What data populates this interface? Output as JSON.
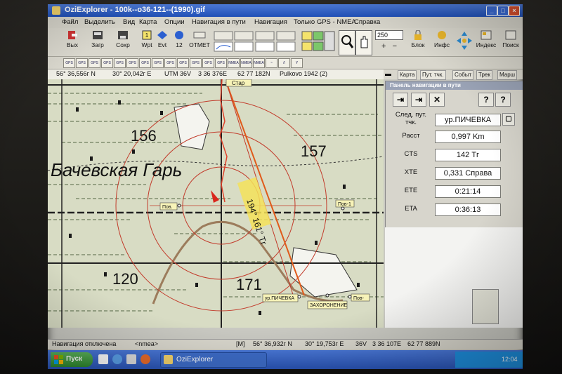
{
  "window": {
    "title": "OziExplorer - 100k--o36-121--(1990).gif"
  },
  "menu": [
    "Файл",
    "Выделить",
    "Вид",
    "Карта",
    "Опции",
    "Навигация в пути",
    "Навигация",
    "Только GPS - NMEA",
    "Справка"
  ],
  "toolbar": {
    "exit_label": "Вых",
    "load_label": "Загр",
    "save_label": "Сохр",
    "wpt_label": "Wpt",
    "evt_label": "Evt",
    "wpt_count": "12",
    "otmec_label": "ОТМЕТ",
    "zoom_value": "250",
    "block_label": "Блок",
    "info_label": "Инфс",
    "index_label": "Индекс",
    "search_label": "Поиск"
  },
  "coords": {
    "lat": "56° 36,556г N",
    "lon": "30° 20,042г E",
    "utm": "UTM  36V",
    "easting": "3 36 376E",
    "northing": "62 77 182N",
    "datum": "Pulkovo 1942 (2)"
  },
  "tabs": [
    "Карта",
    "Пут. тчк.",
    "Событ",
    "Трек",
    "Марш"
  ],
  "nav_panel": {
    "title": "Панель навигации в пути",
    "next_wpt_label": "След. пут. тчк.",
    "next_wpt_value": "ур.ПИЧЕВКА",
    "dist_label": "Расст",
    "dist_value": "0,997 Km",
    "cts_label": "CTS",
    "cts_value": "142 Тг",
    "xte_label": "XTE",
    "xte_value": "0,331 Справа",
    "ete_label": "ETE",
    "ete_value": "0:21:14",
    "eta_label": "ETA",
    "eta_value": "0:36:13"
  },
  "map": {
    "numbers": [
      "156",
      "157",
      "120",
      "171"
    ],
    "place_name": "Бачевская Гарь",
    "bearing_label": "194° 161° Тг",
    "labels": {
      "top": "Стар",
      "left": "Пов.",
      "right": "Пов-1",
      "target": "ур.ПИЧЕВКА",
      "cemetery": "ЗАХОРОНЕНИЕ",
      "far": "Пов-"
    }
  },
  "status": {
    "nav": "Навигация отключена",
    "nmea": "<nmea>",
    "mode": "[M]",
    "lat": "56° 36,932г N",
    "lon": "30° 19,753г E",
    "utm": "36V",
    "easting": "3 36 107E",
    "northing": "62 77 889N"
  },
  "taskbar": {
    "start": "Пуск",
    "app": "OziExplorer",
    "clock": "12:04"
  },
  "colors": {
    "title": "#2457c5",
    "map_bg": "#d8dcc4",
    "route": "#e05a1a",
    "rings": "#c23b2b"
  }
}
